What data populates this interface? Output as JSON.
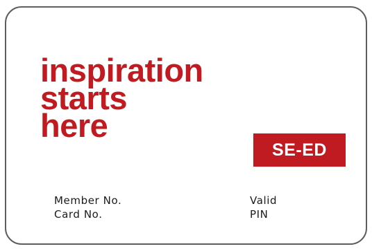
{
  "card": {
    "slogan": [
      "inspiration",
      "starts",
      "here"
    ],
    "logo_text": "SE-ED",
    "fields": {
      "member_no": "Member No.",
      "card_no": "Card No.",
      "valid": "Valid",
      "pin": "PIN"
    }
  },
  "colors": {
    "brand_red": "#c11b22",
    "border": "#5e5e5e",
    "text": "#1a1a1a",
    "background": "#ffffff"
  }
}
